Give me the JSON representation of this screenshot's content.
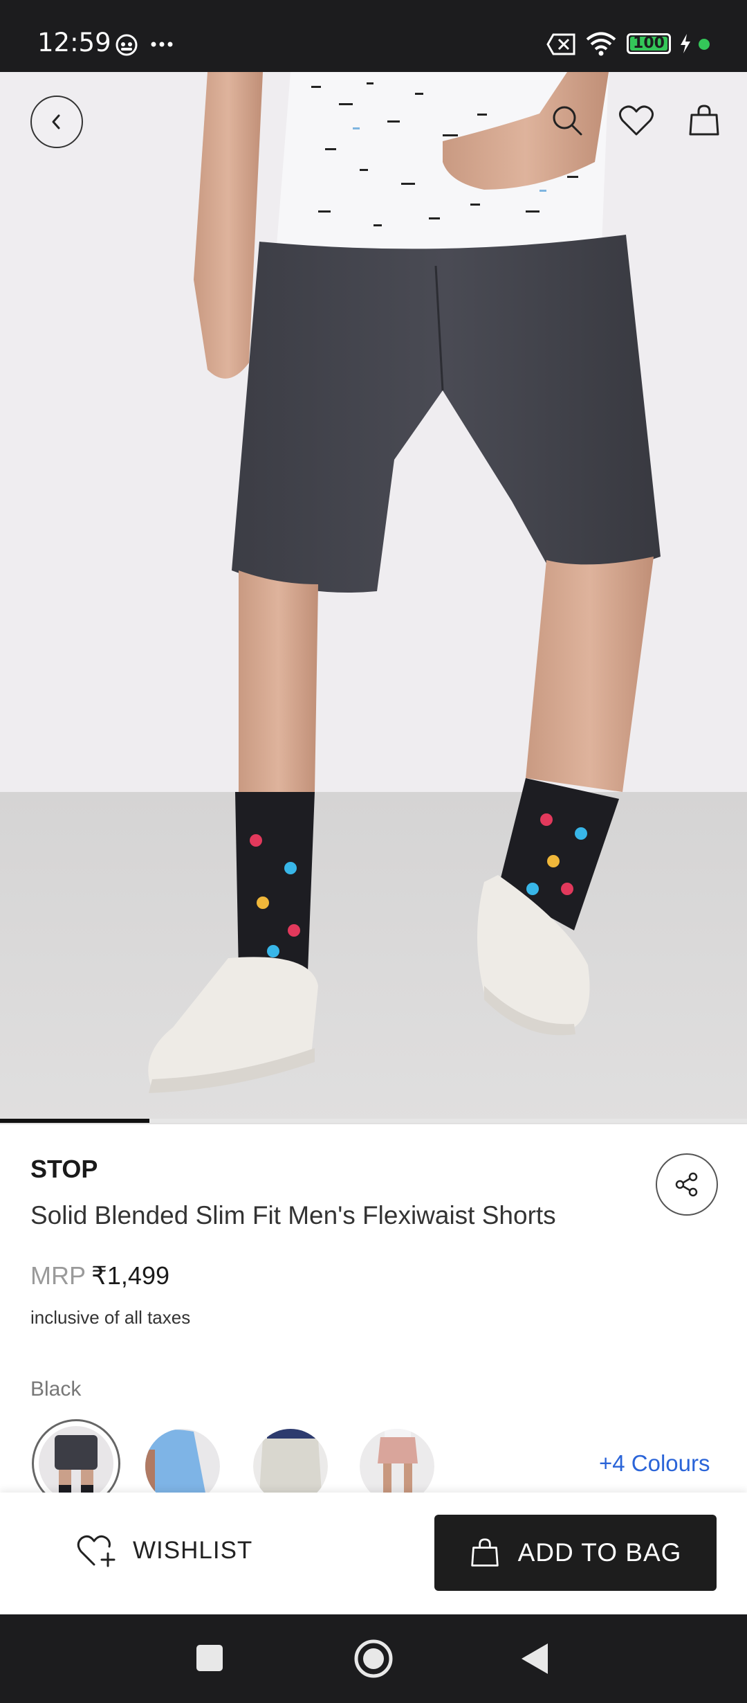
{
  "status_bar": {
    "time": "12:59",
    "battery": "100",
    "icons": [
      "app-notification-icon",
      "more-dots-icon",
      "sim-off-icon",
      "wifi-icon",
      "battery-icon",
      "charging-icon",
      "active-dot-icon"
    ]
  },
  "header": {
    "icons": [
      "back-icon",
      "search-icon",
      "heart-icon",
      "bag-icon"
    ]
  },
  "gallery": {
    "progress_fraction": 0.2
  },
  "product": {
    "brand": "STOP",
    "title": "Solid Blended Slim Fit Men's Flexiwaist Shorts",
    "mrp_label": "MRP",
    "price": "₹1,499",
    "tax_note": "inclusive of all taxes",
    "selected_color": "Black",
    "more_colours": "+4 Colours"
  },
  "swatches": [
    {
      "name": "black",
      "selected": true
    },
    {
      "name": "blue",
      "selected": false
    },
    {
      "name": "grey",
      "selected": false
    },
    {
      "name": "pink",
      "selected": false
    }
  ],
  "actions": {
    "wishlist": "WISHLIST",
    "add_to_bag": "ADD TO BAG"
  },
  "colors": {
    "accent_link": "#2a64d8",
    "primary_button": "#1d1d1d",
    "system_bar": "#1c1c1e",
    "battery_green": "#34c759"
  }
}
